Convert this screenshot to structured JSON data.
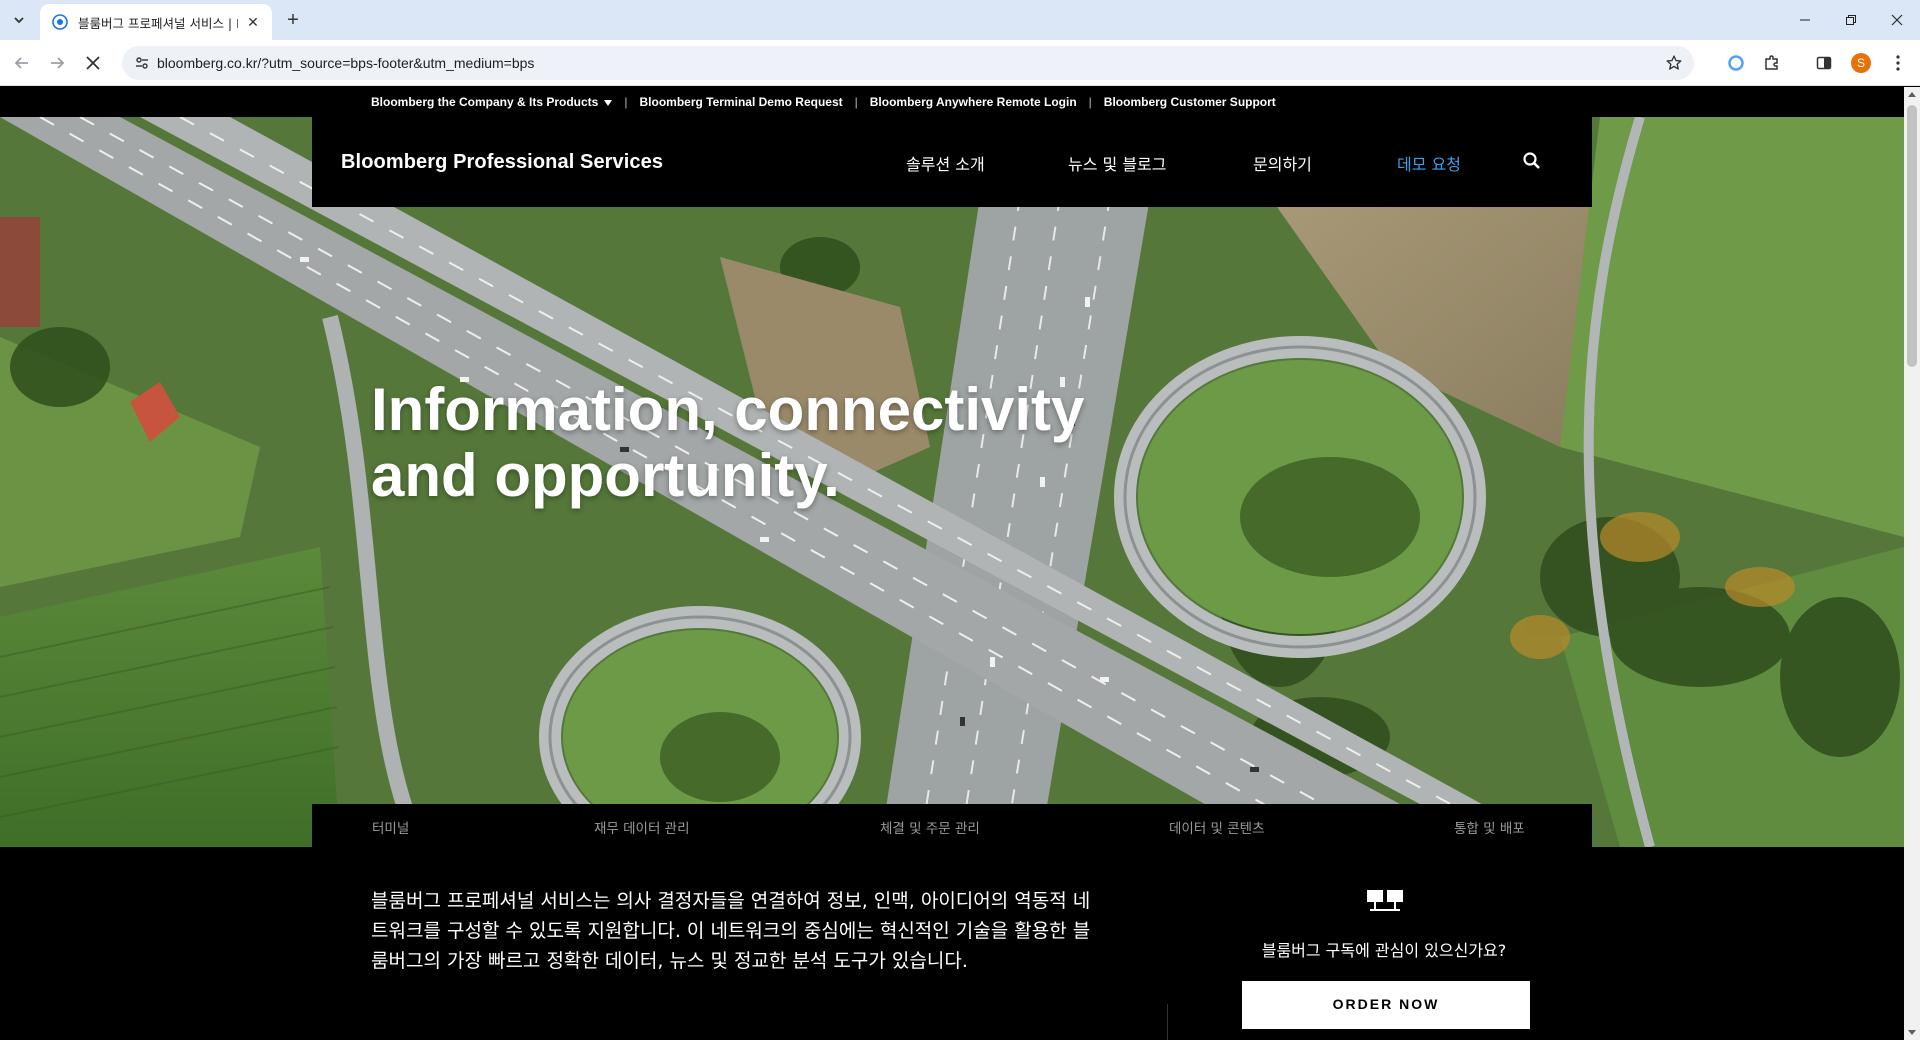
{
  "browser": {
    "tab_title": "블룸버그 프로페셔널 서비스 | Bloomberg",
    "url": "bloomberg.co.kr/?utm_source=bps-footer&utm_medium=bps",
    "profile_initial": "S",
    "icons": [
      "tab-search-icon",
      "favicon-icon",
      "close-icon",
      "plus-icon",
      "minimize-icon",
      "restore-icon",
      "close-window-icon",
      "back-icon",
      "forward-icon",
      "stop-icon",
      "site-info-icon",
      "star-icon",
      "extension-icon",
      "puzzle-icon",
      "side-panel-icon",
      "menu-icon"
    ]
  },
  "utility_bar": {
    "company_link": "Bloomberg the Company & Its Products",
    "demo_link": "Bloomberg Terminal Demo Request",
    "anywhere_link": "Bloomberg Anywhere Remote Login",
    "support_link": "Bloomberg Customer Support",
    "separator": "|"
  },
  "header": {
    "brand": "Bloomberg Professional Services",
    "nav": {
      "solutions": "솔루션 소개",
      "news": "뉴스 및 블로그",
      "contact": "문의하기",
      "demo": "데모 요청"
    },
    "accent_color": "#3aa0e8"
  },
  "hero": {
    "title_line1": "Information, connectivity",
    "title_line2": "and opportunity."
  },
  "subnav": {
    "terminal": "터미널",
    "finance": "재무 데이터 관리",
    "trading": "체결 및 주문 관리",
    "data": "데이터 및 콘텐츠",
    "integration": "통합 및 배포"
  },
  "content": {
    "intro": "블룸버그 프로페셔널 서비스는 의사 결정자들을 연결하여 정보, 인맥, 아이디어의 역동적 네트워크를 구성할 수 있도록 지원합니다. 이 네트워크의 중심에는 혁신적인 기술을 활용한 블룸버그의 가장 빠르고 정확한 데이터, 뉴스 및 정교한 분석 도구가 있습니다.",
    "subscribe_question": "블룸버그 구독에 관심이 있으신가요?",
    "order_button": "ORDER NOW"
  }
}
